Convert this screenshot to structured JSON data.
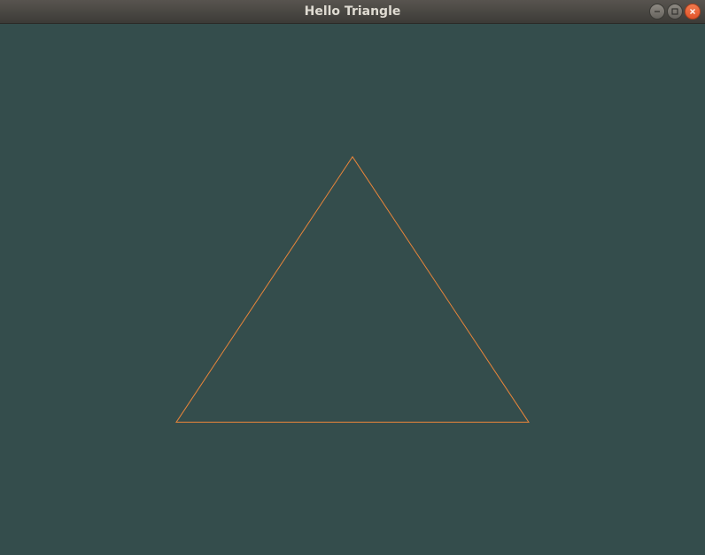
{
  "window": {
    "title": "Hello Triangle",
    "controls": [
      "minimize-icon",
      "maximize-icon",
      "close-icon"
    ]
  },
  "scene": {
    "clear_color": "#344d4c",
    "triangle": {
      "render_mode": "wireframe",
      "stroke_color": "#e8853a",
      "vertices_ndc": [
        [
          -0.5,
          -0.5
        ],
        [
          0.5,
          -0.5
        ],
        [
          0.0,
          0.5
        ]
      ]
    }
  }
}
